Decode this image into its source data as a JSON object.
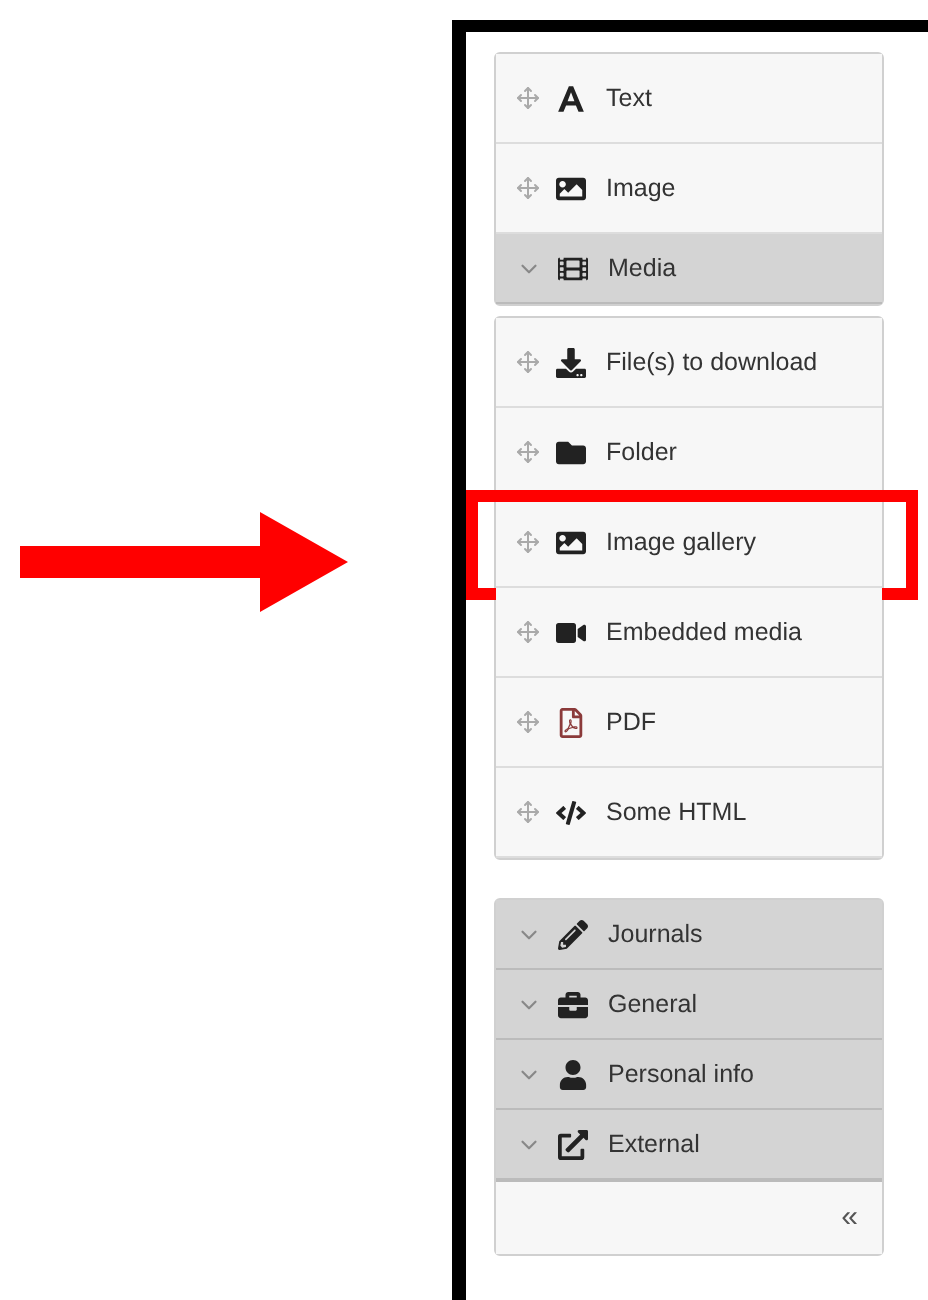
{
  "groups": [
    {
      "items": [
        {
          "kind": "block",
          "label": "Text",
          "highlighted": false
        },
        {
          "kind": "block",
          "label": "Image",
          "highlighted": false
        },
        {
          "kind": "category",
          "label": "Media",
          "highlighted": false
        }
      ]
    },
    {
      "items": [
        {
          "kind": "block",
          "label": "File(s) to download",
          "highlighted": false
        },
        {
          "kind": "block",
          "label": "Folder",
          "highlighted": false
        },
        {
          "kind": "block",
          "label": "Image gallery",
          "highlighted": true
        },
        {
          "kind": "block",
          "label": "Embedded media",
          "highlighted": false
        },
        {
          "kind": "block",
          "label": "PDF",
          "highlighted": false
        },
        {
          "kind": "block",
          "label": "Some HTML",
          "highlighted": false
        }
      ]
    },
    {
      "items": [
        {
          "kind": "category",
          "label": "Journals",
          "highlighted": false
        },
        {
          "kind": "category",
          "label": "General",
          "highlighted": false
        },
        {
          "kind": "category",
          "label": "Personal info",
          "highlighted": false
        },
        {
          "kind": "category",
          "label": "External",
          "highlighted": false
        }
      ],
      "footer": {
        "collapse_label": "«"
      }
    }
  ]
}
